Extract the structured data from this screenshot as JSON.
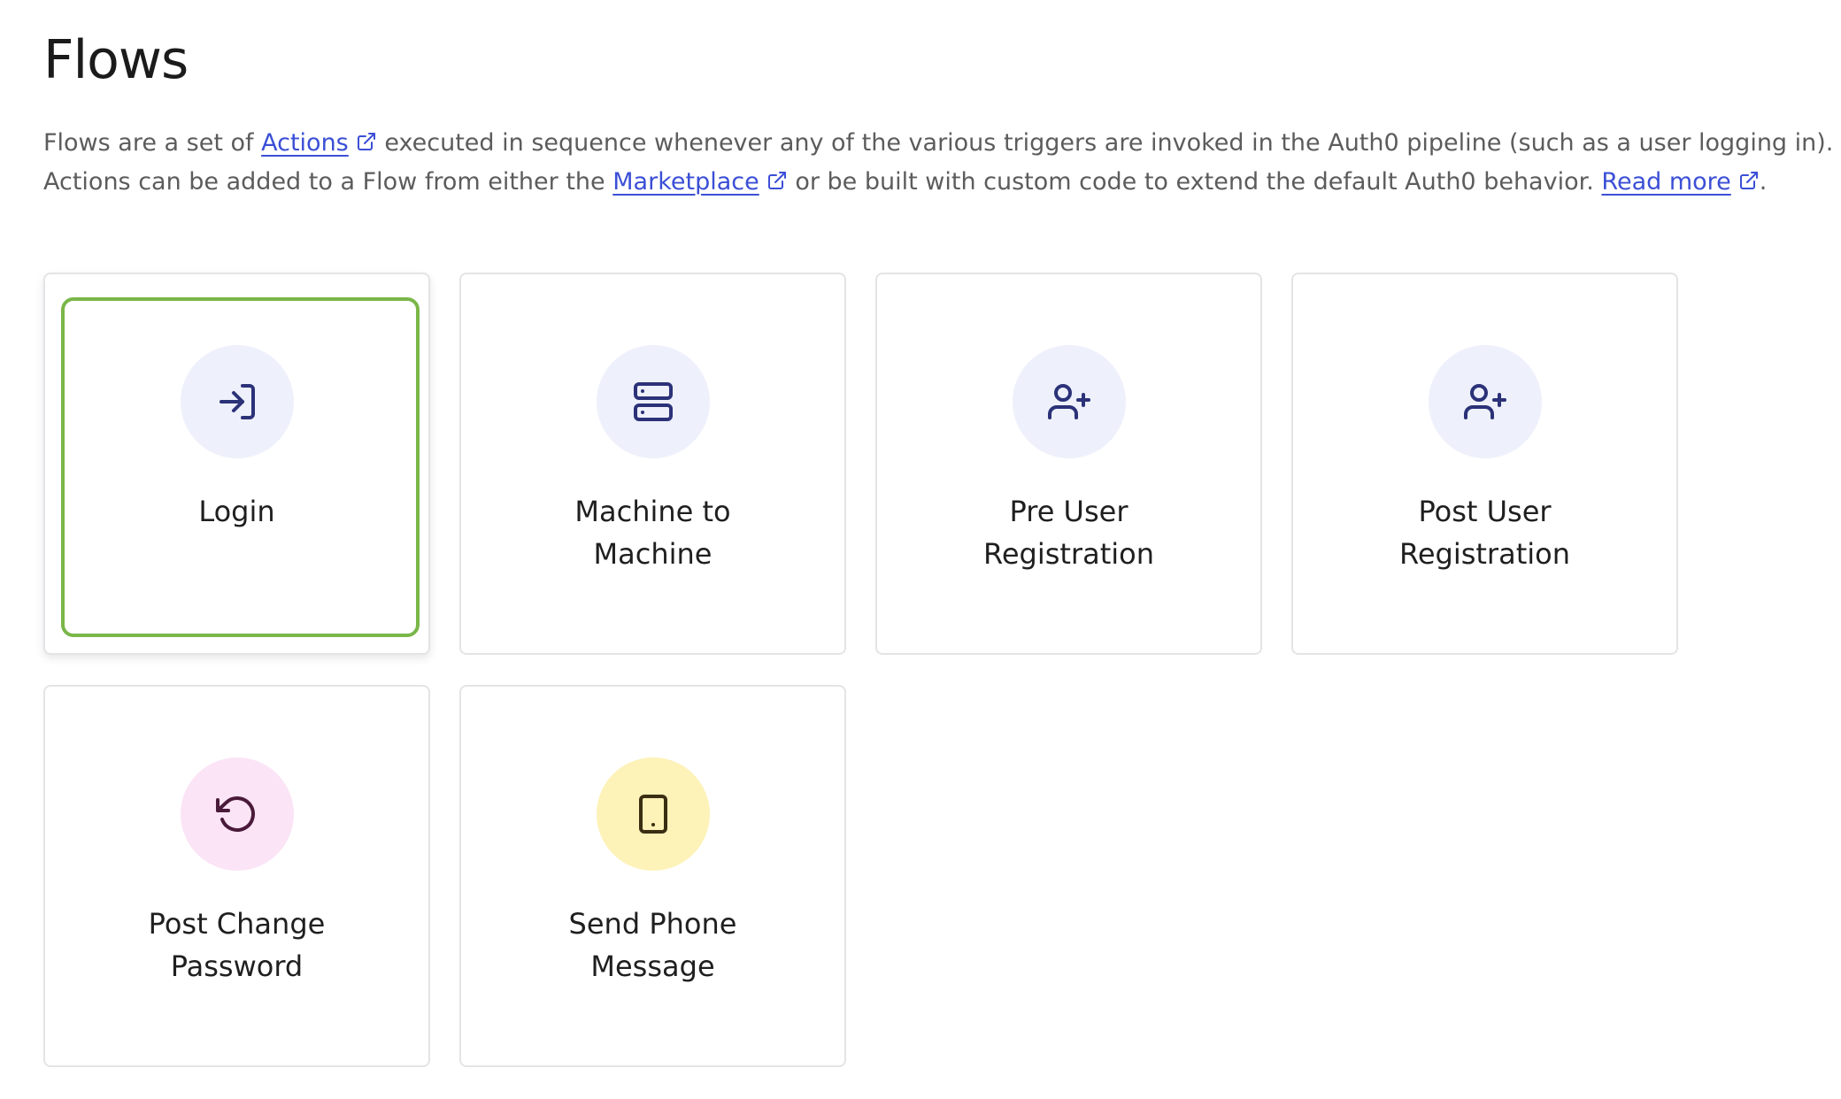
{
  "header": {
    "title": "Flows"
  },
  "description": {
    "line1_pre": "Flows are a set of",
    "actions_link": "Actions",
    "line1_post": "executed in sequence whenever any of the various triggers are invoked in the Auth0 pipeline (such as a user logging in).",
    "line2_pre": "Actions can be added to a Flow from either the",
    "marketplace_link": "Marketplace",
    "line2_mid": "or be built with custom code to extend the default Auth0 behavior.",
    "read_more_link": "Read more",
    "line2_end": "."
  },
  "colors": {
    "link": "#3b4fd6",
    "selected_outline": "#7ab648",
    "blue_circle": "#eef0fb",
    "pink_circle": "#fbe4f6",
    "yellow_circle": "#fdf2b8",
    "blue_icon": "#2b3278",
    "pink_icon": "#4a1a3a",
    "yellow_icon": "#3a2e12"
  },
  "flows": [
    {
      "label": "Login",
      "icon": "login-icon",
      "selected": true
    },
    {
      "label": "Machine to Machine",
      "icon": "server-icon",
      "selected": false
    },
    {
      "label": "Pre User Registration",
      "icon": "user-plus-icon",
      "selected": false
    },
    {
      "label": "Post User Registration",
      "icon": "user-plus-icon",
      "selected": false
    },
    {
      "label": "Post Change Password",
      "icon": "rotate-ccw-icon",
      "selected": false
    },
    {
      "label": "Send Phone Message",
      "icon": "smartphone-icon",
      "selected": false
    }
  ]
}
